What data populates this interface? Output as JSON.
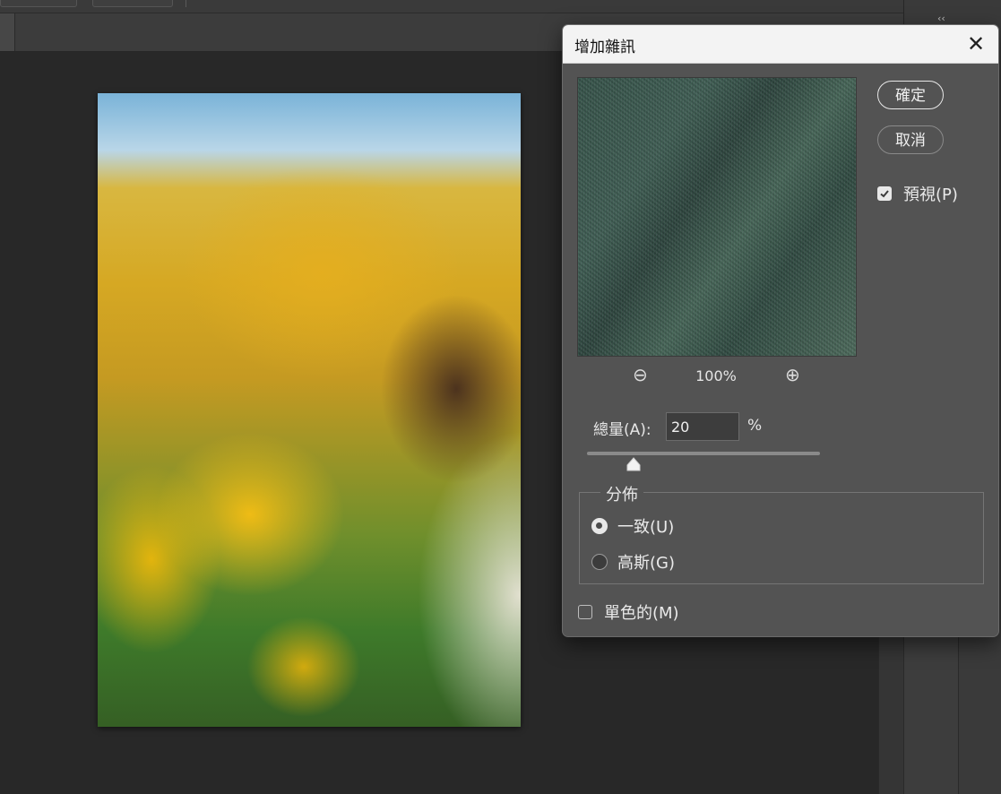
{
  "dialog": {
    "title": "增加雜訊",
    "close_glyph": "✕",
    "ok_label": "確定",
    "cancel_label": "取消",
    "preview_check_label": "預視(P)",
    "preview_checked": true,
    "zoom_value": "100%",
    "zoom_out_glyph": "⊖",
    "zoom_in_glyph": "⊕",
    "amount_label": "總量(A):",
    "amount_value": "20",
    "amount_unit": "%",
    "amount_slider_fraction": 0.2,
    "distribution": {
      "legend": "分佈",
      "options": [
        {
          "label": "一致(U)",
          "selected": true
        },
        {
          "label": "高斯(G)",
          "selected": false
        }
      ]
    },
    "monochrome_label": "單色的(M)",
    "monochrome_checked": false
  },
  "workspace": {
    "dock_collapse_glyph": "‹‹"
  },
  "icons": {
    "close": "close-icon",
    "zoom_out": "zoom-out-icon",
    "zoom_in": "zoom-in-icon",
    "check": "checkmark-icon",
    "slider_thumb": "triangle-slider-thumb-icon"
  }
}
